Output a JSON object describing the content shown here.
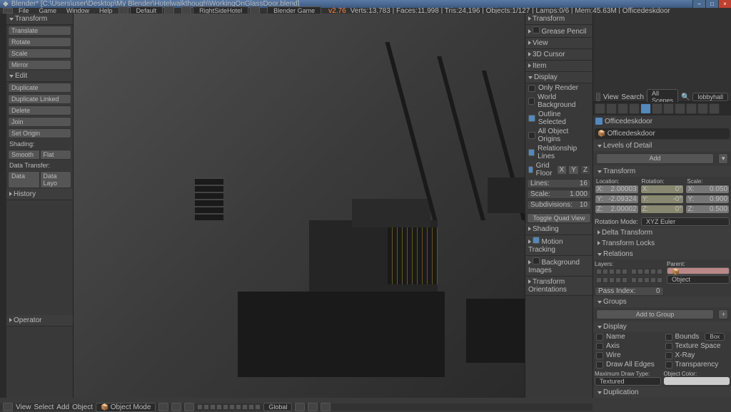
{
  "title": "Blender* [C:\\Users\\user\\Desktop\\My Blender\\Hotelwalkthough\\WorkingOnGlassDoor.blend]",
  "menu": {
    "file": "File",
    "game": "Game",
    "window": "Window",
    "help": "Help"
  },
  "layout_preset": "Default",
  "scene_name": "RightSideHotel",
  "engine": "Blender Game",
  "version": "v2.76",
  "stats": "Verts:13,783 | Faces:11,998 | Tris:24,196 | Objects:1/127 | Lamps:0/6 | Mem:45.63M | Officedeskdoor",
  "left": {
    "transform_hdr": "Transform",
    "translate": "Translate",
    "rotate": "Rotate",
    "scale": "Scale",
    "mirror": "Mirror",
    "edit_hdr": "Edit",
    "duplicate": "Duplicate",
    "dup_linked": "Duplicate Linked",
    "delete": "Delete",
    "join": "Join",
    "set_origin": "Set Origin",
    "shading_hdr": "Shading:",
    "smooth": "Smooth",
    "flat": "Flat",
    "data_hdr": "Data Transfer:",
    "data": "Data",
    "data_layo": "Data Layo",
    "history": "History",
    "operator": "Operator"
  },
  "right": {
    "transform": "Transform",
    "grease": "Grease Pencil",
    "view": "View",
    "cursor": "3D Cursor",
    "item": "Item",
    "display": "Display",
    "only_render": "Only Render",
    "world_bg": "World Background",
    "outline": "Outline Selected",
    "all_origins": "All Object Origins",
    "rel_lines": "Relationship Lines",
    "grid_floor": "Grid Floor",
    "lines": "Lines:",
    "lines_v": "16",
    "sscale": "Scale:",
    "scale_v": "1.000",
    "subdiv": "Subdivisions:",
    "subdiv_v": "10",
    "toggle_quad": "Toggle Quad View",
    "shading": "Shading",
    "motion": "Motion Tracking",
    "bg_img": "Background Images",
    "t_orient": "Transform Orientations"
  },
  "outliner": {
    "view": "View",
    "search": "Search",
    "all_scenes": "All Scenes",
    "scene": "lobbyhall"
  },
  "props": {
    "obj": "Officedeskdoor",
    "obj2": "Officedeskdoor",
    "lod": "Levels of Detail",
    "add": "Add",
    "transform": "Transform",
    "loc_lbl": "Location:",
    "rot_lbl": "Rotation:",
    "scale_lbl": "Scale:",
    "loc": {
      "x": "X:",
      "xv": "2.00003",
      "y": "Y:",
      "yv": "-2.09324",
      "z": "Z:",
      "zv": "2.00002"
    },
    "rot": {
      "x": "X:",
      "xv": "0°",
      "y": "Y:",
      "yv": "-0°",
      "z": "Z:",
      "zv": "0°"
    },
    "scl": {
      "x": "X:",
      "xv": "0.050",
      "y": "Y:",
      "yv": "0.900",
      "z": "Z:",
      "zv": "0.500"
    },
    "rot_mode": "Rotation Mode:",
    "rot_mode_v": "XYZ Euler",
    "delta": "Delta Transform",
    "locks": "Transform Locks",
    "relations": "Relations",
    "layers": "Layers:",
    "parent": "Parent:",
    "parent_obj": "Object",
    "pass": "Pass Index:",
    "pass_v": "0",
    "groups": "Groups",
    "add_group": "Add to Group",
    "display2": "Display",
    "name": "Name",
    "bounds": "Bounds",
    "box": "Box",
    "axis": "Axis",
    "tex_space": "Texture Space",
    "wire": "Wire",
    "xray": "X-Ray",
    "draw_edges": "Draw All Edges",
    "transp": "Transparency",
    "max_draw": "Maximum Draw Type:",
    "textured": "Textured",
    "obj_color": "Object Color:",
    "dup": "Duplication"
  },
  "bottom": {
    "view": "View",
    "select": "Select",
    "add": "Add",
    "object": "Object",
    "mode": "Object Mode",
    "global": "Global"
  }
}
